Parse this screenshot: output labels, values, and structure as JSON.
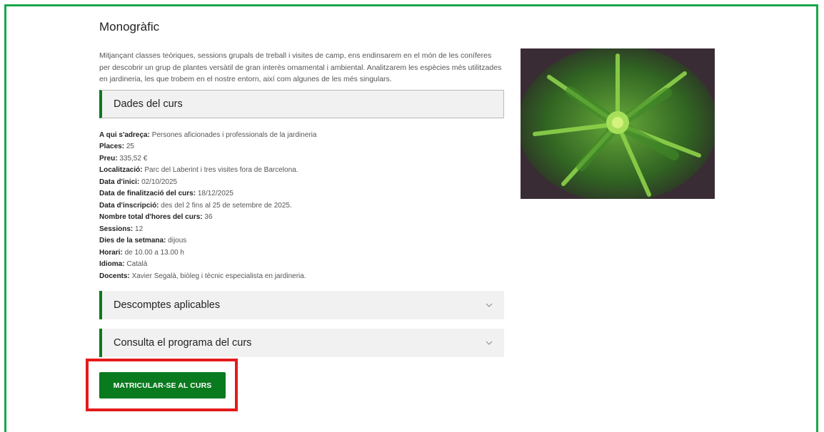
{
  "page": {
    "title": "Monogràfic",
    "intro": "Mitjançant classes teòriques, sessions grupals de treball i visites de camp, ens endinsarem en el món de les coníferes per descobrir un grup de plantes versàtil de gran interès ornamental i ambiental. Analitzarem les espècies més utilitzades en jardineria, les que trobem en el nostre entorn, així com algunes de les més singulars."
  },
  "course_panel": {
    "title": "Dades del curs"
  },
  "details": [
    {
      "label": "A qui s'adreça:",
      "value": "Persones aficionades i professionals de la jardineria"
    },
    {
      "label": "Places:",
      "value": "25"
    },
    {
      "label": "Preu:",
      "value": "335,52 €"
    },
    {
      "label": "Localització:",
      "value": "Parc del Laberint i tres visites fora de Barcelona."
    },
    {
      "label": "Data d'inici:",
      "value": "02/10/2025"
    },
    {
      "label": "Data de finalització del curs:",
      "value": "18/12/2025"
    },
    {
      "label": "Data d'inscripció:",
      "value": "des del 2 fins al 25 de setembre de 2025."
    },
    {
      "label": "Nombre total d'hores del curs:",
      "value": "36"
    },
    {
      "label": "Sessions:",
      "value": "12"
    },
    {
      "label": "Dies de la setmana:",
      "value": "dijous"
    },
    {
      "label": "Horari:",
      "value": "de 10.00 a 13.00 h"
    },
    {
      "label": "Idioma:",
      "value": "Català"
    },
    {
      "label": "Docents:",
      "value": "Xavier Segalà, biòleg i tècnic especialista en jardineria."
    }
  ],
  "accordions": [
    {
      "title": "Descomptes aplicables",
      "icon": "chevron-down-icon"
    },
    {
      "title": "Consulta el programa del curs",
      "icon": "chevron-down-icon"
    }
  ],
  "cta": {
    "label": "MATRICULAR-SE AL CURS"
  },
  "colors": {
    "accent": "#0a7a1f",
    "frame": "#17a84a",
    "highlight": "#e41b1b"
  }
}
